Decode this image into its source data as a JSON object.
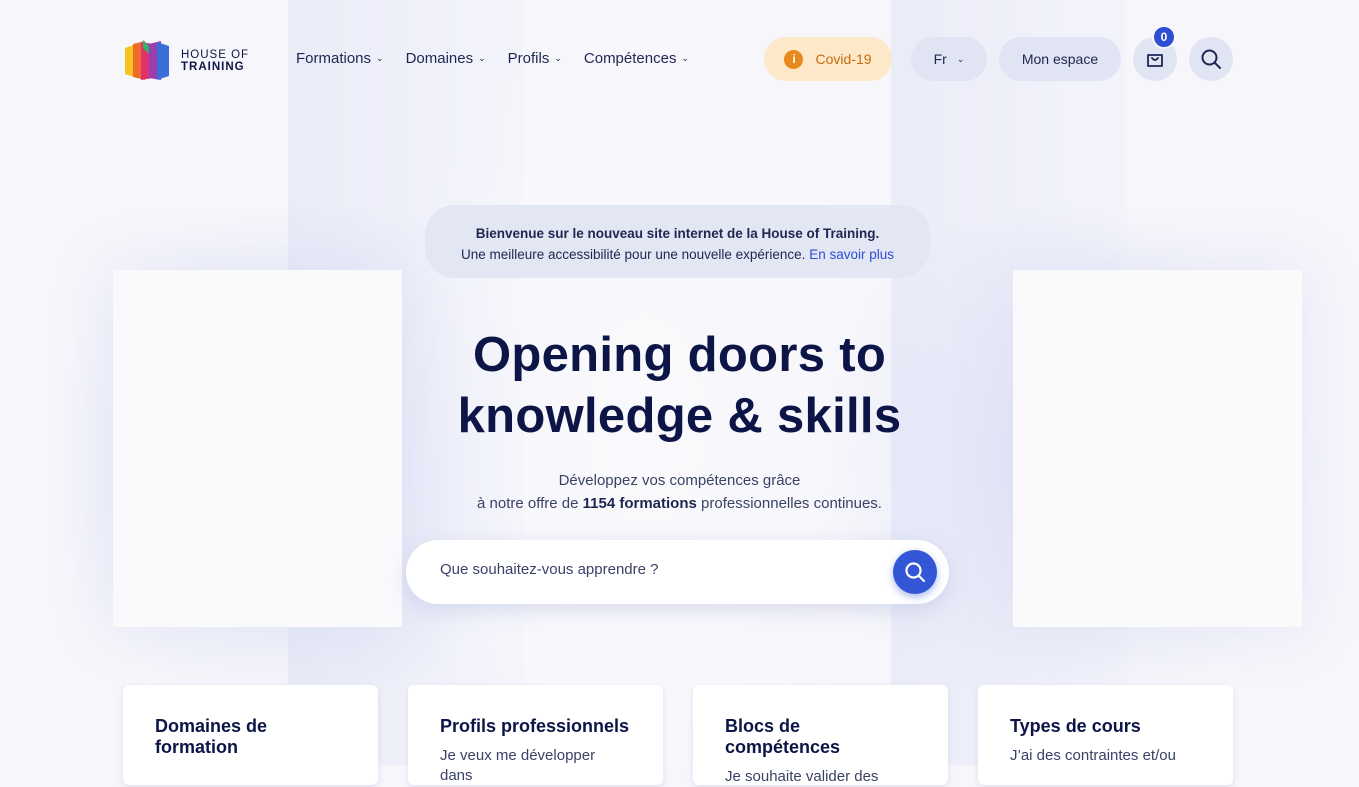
{
  "header": {
    "logo": {
      "line1": "HOUSE OF",
      "line2": "TRAINING"
    },
    "nav": [
      {
        "label": "Formations"
      },
      {
        "label": "Domaines"
      },
      {
        "label": "Profils"
      },
      {
        "label": "Compétences"
      }
    ],
    "covid_label": "Covid-19",
    "lang_label": "Fr",
    "space_label": "Mon espace",
    "cart_count": "0"
  },
  "banner": {
    "line1": "Bienvenue sur le nouveau site internet de la House of Training.",
    "line2": "Une meilleure accessibilité pour une nouvelle expérience.",
    "link": "En savoir plus"
  },
  "hero": {
    "title_line1": "Opening doors to",
    "title_line2": "knowledge & skills",
    "sub_line1": "Développez vos compétences grâce",
    "sub_line2_prefix": "à notre offre de",
    "sub_line2_bold": "1154 formations",
    "sub_line2_suffix": "professionnelles continues."
  },
  "search": {
    "placeholder": "Que souhaitez-vous apprendre ?"
  },
  "cards": [
    {
      "title": "Domaines de formation",
      "desc": ""
    },
    {
      "title": "Profils professionnels",
      "desc": "Je veux me développer dans"
    },
    {
      "title": "Blocs de compétences",
      "desc": "Je souhaite valider des"
    },
    {
      "title": "Types de cours",
      "desc": "J’ai des contraintes et/ou"
    }
  ],
  "colors": {
    "accent": "#3256d6",
    "navy": "#0d1547",
    "covid_bg": "#fde8c9",
    "covid_icon": "#e8891d"
  }
}
